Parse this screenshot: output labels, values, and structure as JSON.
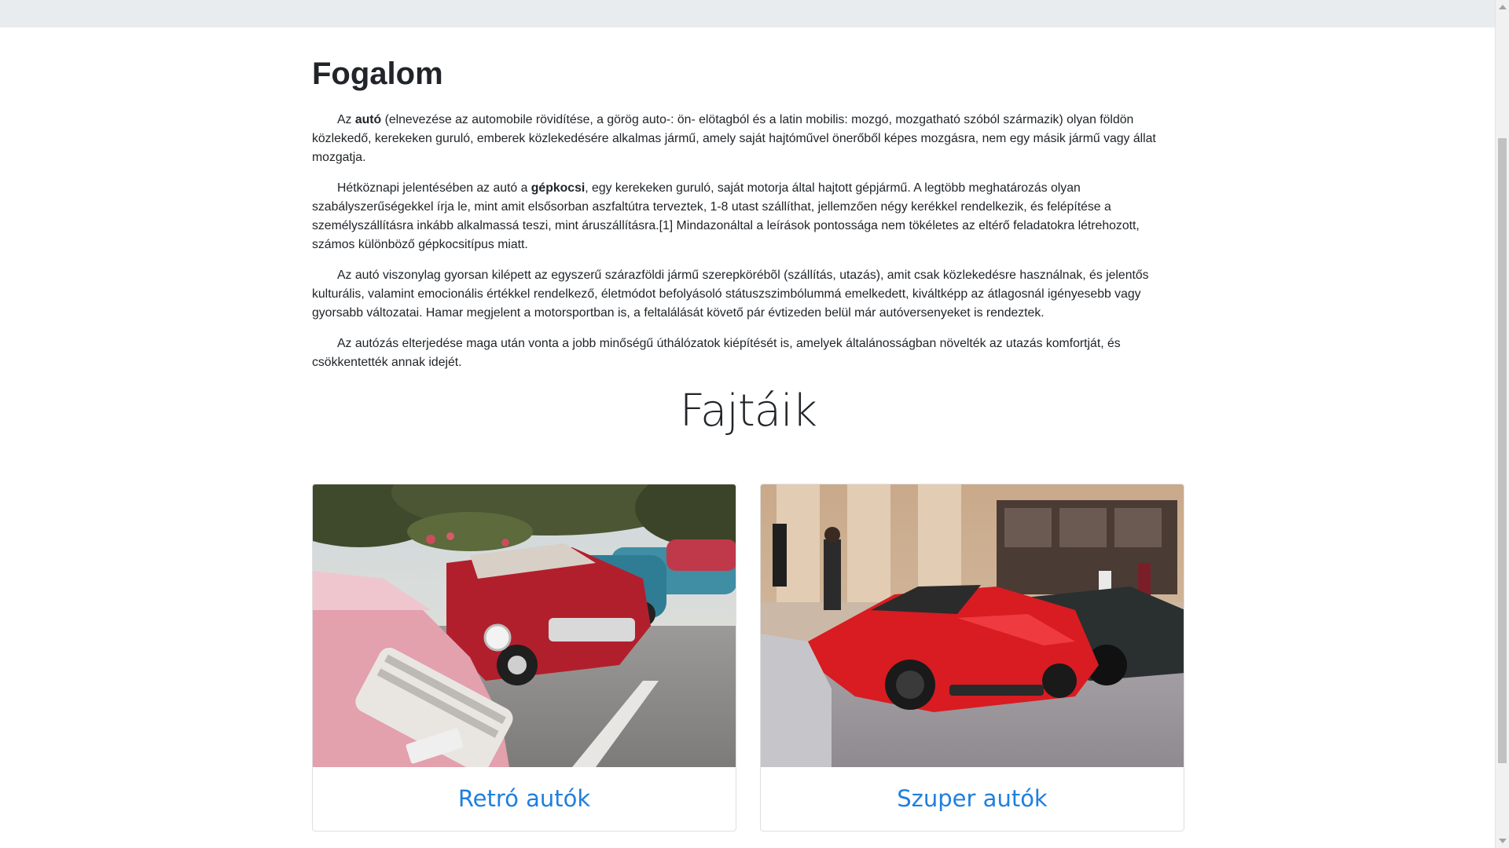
{
  "concept": {
    "title": "Fogalom",
    "paragraphs": [
      {
        "pre": "Az ",
        "bold": "autó",
        "post": " (elnevezése az automobile rövidítése, a görög auto-: ön- elötagból és a latin mobilis: mozgó, mozgatható szóból származik) olyan földön közlekedő, kerekeken guruló, emberek közlekedésére alkalmas jármű, amely saját hajtóművel önerőből képes mozgásra, nem egy másik jármű vagy állat mozgatja."
      },
      {
        "pre": "Hétköznapi jelentésében az autó a ",
        "bold": "gépkocsi",
        "post": ", egy kerekeken guruló, saját motorja által hajtott gépjármű. A legtöbb meghatározás olyan szabályszerűségekkel írja le, mint amit elsősorban aszfaltútra terveztek, 1-8 utast szállíthat, jellemzően négy kerékkel rendelkezik, és felépítése a személyszállításra inkább alkalmassá teszi, mint áruszállításra.[1] Mindazonáltal a leírások pontossága nem tökéletes az eltérő feladatokra létrehozott, számos különböző gépkocsitípus miatt."
      },
      {
        "pre": "Az autó viszonylag gyorsan kilépett az egyszerű szárazföldi jármű szerepkörébõl (szállítás, utazás), amit csak közlekedésre használnak, és jelentős kulturális, valamint emocionális értékkel rendelkező, életmódot befolyásoló státuszszimbólummá emelkedett, kiváltképp az átlagosnál igényesebb vagy gyorsabb változatai. Hamar megjelent a motorsportban is, a feltalálását követő pár évtizeden belül már autóversenyeket is rendeztek.",
        "bold": "",
        "post": ""
      },
      {
        "pre": "Az autózás elterjedése maga után vonta a jobb minőségű úthálózatok kiépítését is, amelyek általánosságban növelték az utazás komfortját, és csökkentették annak idejét.",
        "bold": "",
        "post": ""
      }
    ]
  },
  "types": {
    "title": "Fajtáik",
    "cards": [
      {
        "label": "Retró autók",
        "image_icon": "retro-cars-photo"
      },
      {
        "label": "Szuper autók",
        "image_icon": "super-cars-photo"
      }
    ]
  },
  "colors": {
    "link": "#1f7fe0",
    "navbar": "#e9ecef"
  }
}
